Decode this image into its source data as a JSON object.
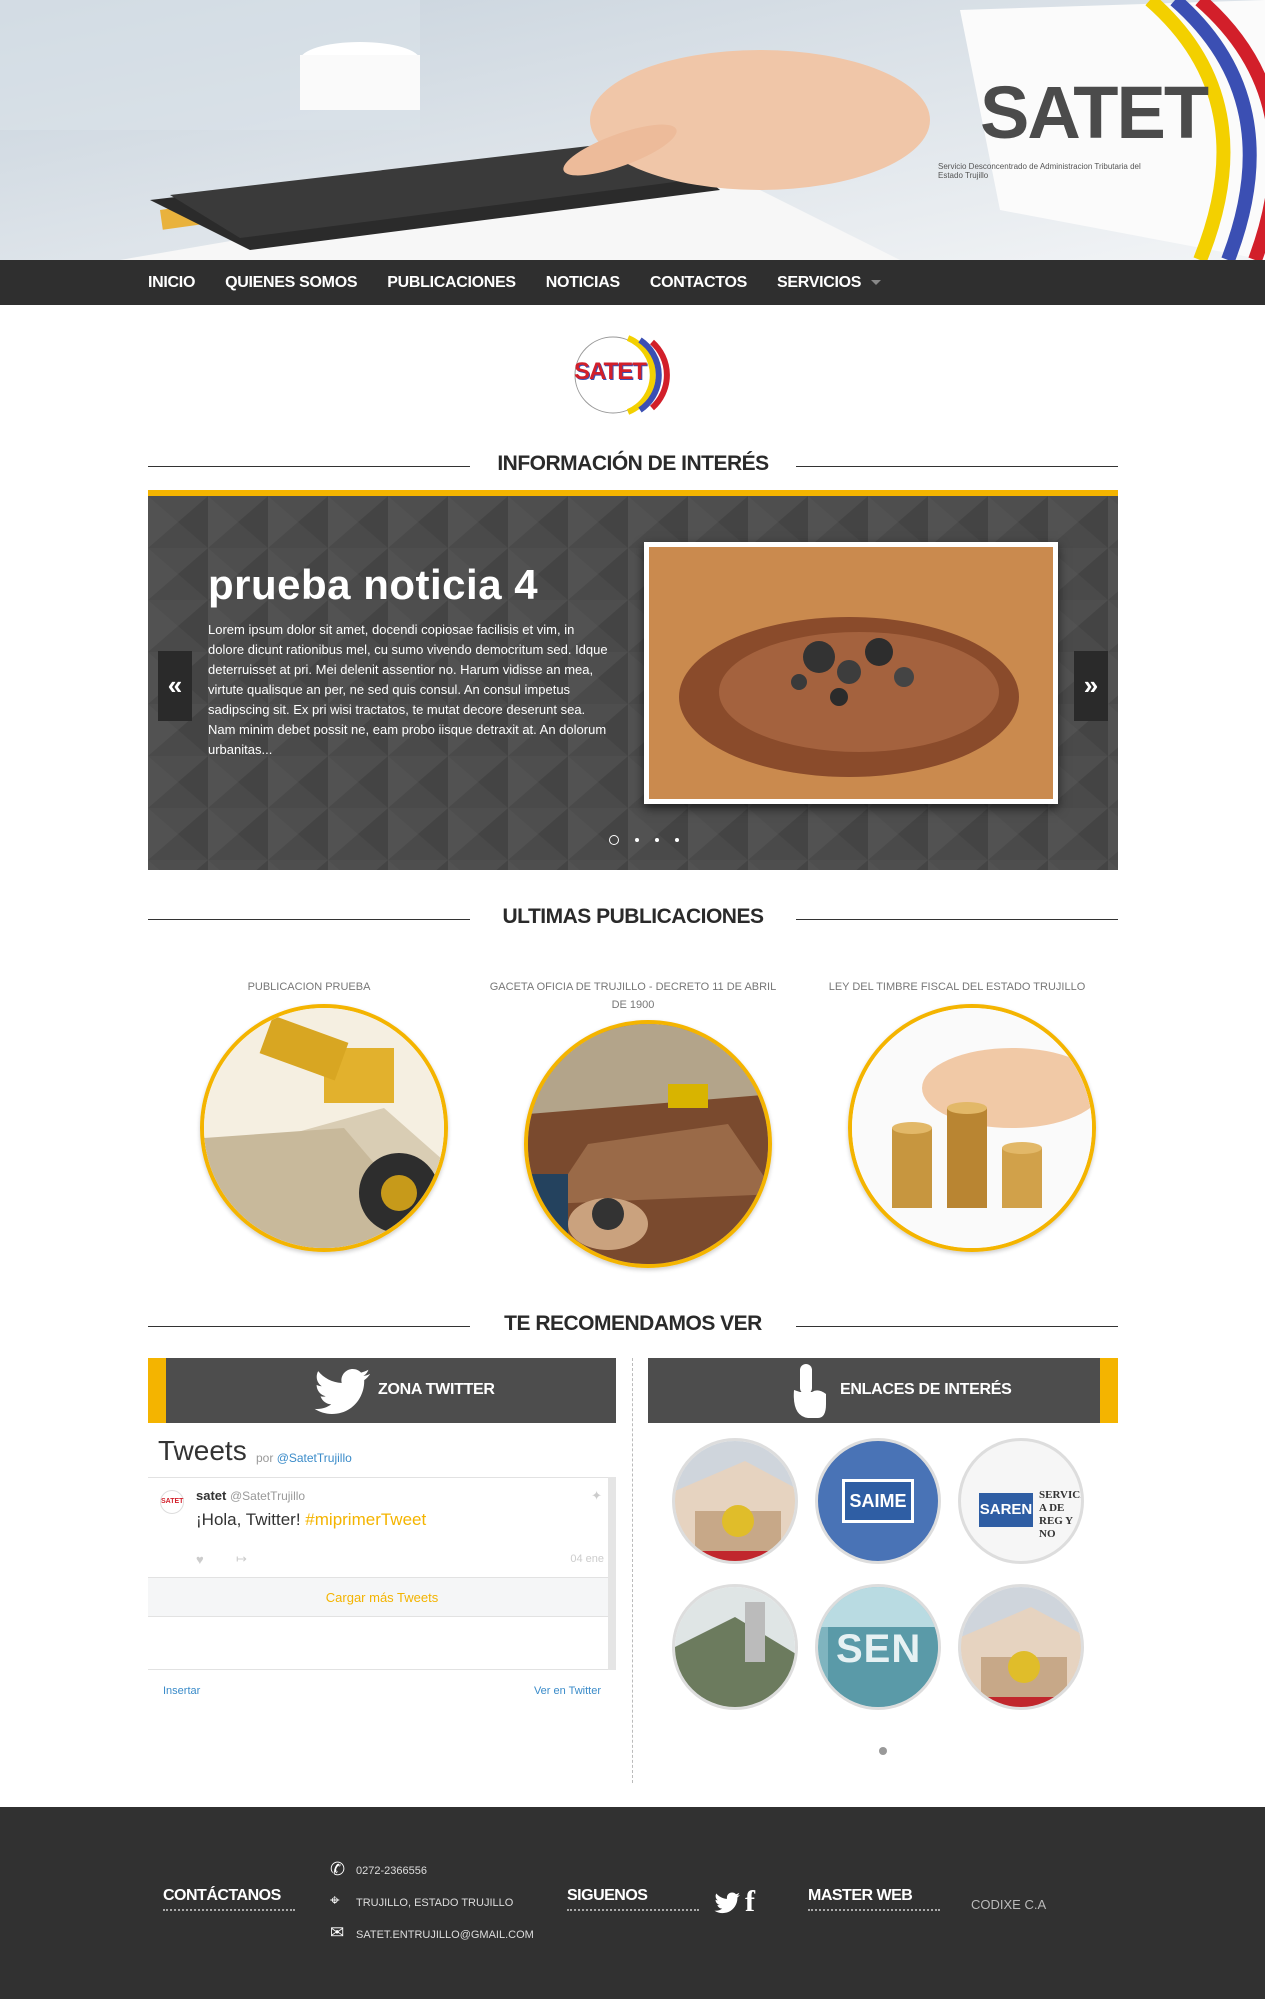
{
  "header": {
    "brand": "SATET",
    "brand_subtitle": "Servicio Desconcentrado de Administracion Tributaria del Estado Trujillo"
  },
  "nav": {
    "items": [
      "INICIO",
      "QUIENES SOMOS",
      "PUBLICACIONES",
      "NOTICIAS",
      "CONTACTOS",
      "SERVICIOS"
    ]
  },
  "logo": {
    "text": "SATET"
  },
  "sections": {
    "info": "INFORMACIÓN DE INTERÉS",
    "pubs": "ULTIMAS PUBLICACIONES",
    "recommend": "TE RECOMENDAMOS VER"
  },
  "slider": {
    "title": "prueba noticia 4",
    "text": "Lorem ipsum dolor sit amet, docendi copiosae facilisis et vim, in dolore dicunt rationibus mel, cu sumo vivendo democritum sed. Idque deterruisset at pri. Mei delenit assentior no. Harum vidisse an mea, virtute qualisque an per, ne sed quis consul. An consul impetus sadipscing sit. Ex pri wisi tractatos, te mutat decore deserunt sea. Nam minim debet possit ne, eam probo iisque detraxit at. An dolorum urbanitas...",
    "prev": "«",
    "next": "»",
    "dots": 4,
    "active_dot": 0
  },
  "publications": [
    {
      "caption": "PUBLICACION PRUEBA"
    },
    {
      "caption": "GACETA OFICIA DE TRUJILLO - DECRETO 11 DE ABRIL DE 1900"
    },
    {
      "caption": "LEY DEL TIMBRE FISCAL DEL ESTADO TRUJILLO"
    }
  ],
  "twitter": {
    "panel_title": "ZONA TWITTER",
    "widget_title": "Tweets",
    "by_label": "por",
    "by_handle": "@SatetTrujillo",
    "tweet_user": "satet",
    "tweet_handle": "@SatetTrujillo",
    "tweet_text": "¡Hola, Twitter!",
    "tweet_hashtag": "#miprimerTweet",
    "tweet_date": "04 ene",
    "more_label": "Cargar más Tweets",
    "embed_label": "Insertar",
    "view_label": "Ver en Twitter"
  },
  "links": {
    "panel_title": "ENLACES DE INTERÉS",
    "items": [
      {
        "label": ""
      },
      {
        "label": "SAIME"
      },
      {
        "label": "SAREN",
        "sublabel": "SERVICIO A DE REG Y NO"
      },
      {
        "label": ""
      },
      {
        "label": "SEN"
      },
      {
        "label": ""
      }
    ]
  },
  "footer": {
    "contact_title": "CONTÁCTANOS",
    "phone": "0272-2366556",
    "address": "TRUJILLO, ESTADO TRUJILLO",
    "email": "SATET.ENTRUJILLO@GMAIL.COM",
    "follow_title": "SIGUENOS",
    "master_title": "MASTER WEB",
    "master_name": "CODIXE C.A"
  },
  "colors": {
    "accent": "#f4b400",
    "dark": "#2f2f2f",
    "twitter": "#3a8bc9"
  }
}
